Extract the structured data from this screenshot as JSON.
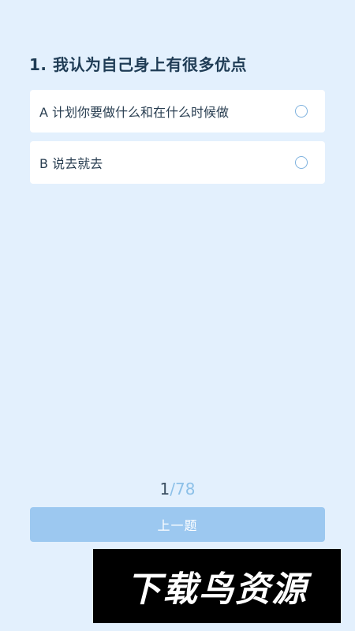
{
  "question": {
    "title": "1. 我认为自己身上有很多优点",
    "options": [
      {
        "label": "A 计划你要做什么和在什么时候做"
      },
      {
        "label": "B 说去就去"
      }
    ]
  },
  "progress": {
    "current": "1",
    "separator": "/",
    "total": "78"
  },
  "buttons": {
    "previous_label": "上一题"
  },
  "watermark": {
    "text": "下载鸟资源"
  },
  "colors": {
    "background": "#e3f0fd",
    "accent": "#9cc8f0"
  }
}
